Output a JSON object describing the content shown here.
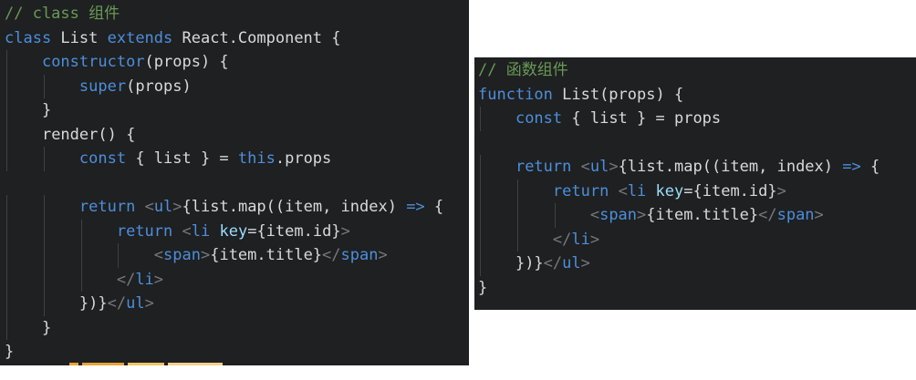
{
  "left_panel": {
    "lines": [
      {
        "indent": 0,
        "tokens": [
          [
            "cm",
            "// class 组件"
          ]
        ]
      },
      {
        "indent": 0,
        "tokens": [
          [
            "kw",
            "class"
          ],
          [
            "plain",
            " List "
          ],
          [
            "kw",
            "extends"
          ],
          [
            "plain",
            " React.Component {"
          ]
        ]
      },
      {
        "indent": 1,
        "tokens": [
          [
            "kw",
            "constructor"
          ],
          [
            "plain",
            "(props) {"
          ]
        ]
      },
      {
        "indent": 2,
        "tokens": [
          [
            "kw",
            "super"
          ],
          [
            "plain",
            "(props)"
          ]
        ]
      },
      {
        "indent": 1,
        "tokens": [
          [
            "plain",
            "}"
          ]
        ]
      },
      {
        "indent": 1,
        "tokens": [
          [
            "plain",
            "render() {"
          ]
        ]
      },
      {
        "indent": 2,
        "tokens": [
          [
            "kw",
            "const"
          ],
          [
            "plain",
            " { list } = "
          ],
          [
            "kw",
            "this"
          ],
          [
            "plain",
            ".props"
          ]
        ]
      },
      {
        "indent": 0,
        "tokens": []
      },
      {
        "indent": 2,
        "tokens": [
          [
            "kw",
            "return"
          ],
          [
            "plain",
            " "
          ],
          [
            "br",
            "<"
          ],
          [
            "tg",
            "ul"
          ],
          [
            "br",
            ">"
          ],
          [
            "plain",
            "{list.map((item, index) "
          ],
          [
            "kw",
            "=>"
          ],
          [
            "plain",
            " {"
          ]
        ]
      },
      {
        "indent": 3,
        "tokens": [
          [
            "kw",
            "return"
          ],
          [
            "plain",
            " "
          ],
          [
            "br",
            "<"
          ],
          [
            "tg",
            "li"
          ],
          [
            "plain",
            " "
          ],
          [
            "at",
            "key"
          ],
          [
            "plain",
            "={item.id}"
          ],
          [
            "br",
            ">"
          ]
        ]
      },
      {
        "indent": 4,
        "tokens": [
          [
            "br",
            "<"
          ],
          [
            "tg",
            "span"
          ],
          [
            "br",
            ">"
          ],
          [
            "plain",
            "{item.title}"
          ],
          [
            "br",
            "</"
          ],
          [
            "tg",
            "span"
          ],
          [
            "br",
            ">"
          ]
        ]
      },
      {
        "indent": 3,
        "tokens": [
          [
            "br",
            "</"
          ],
          [
            "tg",
            "li"
          ],
          [
            "br",
            ">"
          ]
        ]
      },
      {
        "indent": 2,
        "tokens": [
          [
            "plain",
            "})}"
          ],
          [
            "br",
            "</"
          ],
          [
            "tg",
            "ul"
          ],
          [
            "br",
            ">"
          ]
        ]
      },
      {
        "indent": 1,
        "tokens": [
          [
            "plain",
            "}"
          ]
        ]
      },
      {
        "indent": 0,
        "tokens": [
          [
            "plain",
            "}"
          ]
        ]
      }
    ]
  },
  "right_panel": {
    "lines": [
      {
        "indent": 0,
        "tokens": [
          [
            "cm",
            "// 函数组件"
          ]
        ]
      },
      {
        "indent": 0,
        "tokens": [
          [
            "kw",
            "function"
          ],
          [
            "plain",
            " List(props) {"
          ]
        ]
      },
      {
        "indent": 1,
        "tokens": [
          [
            "kw",
            "const"
          ],
          [
            "plain",
            " { list } = "
          ],
          [
            "plain",
            "props"
          ]
        ]
      },
      {
        "indent": 0,
        "tokens": []
      },
      {
        "indent": 1,
        "tokens": [
          [
            "kw",
            "return"
          ],
          [
            "plain",
            " "
          ],
          [
            "br",
            "<"
          ],
          [
            "tg",
            "ul"
          ],
          [
            "br",
            ">"
          ],
          [
            "plain",
            "{list.map((item, index) "
          ],
          [
            "kw",
            "=>"
          ],
          [
            "plain",
            " {"
          ]
        ]
      },
      {
        "indent": 2,
        "tokens": [
          [
            "kw",
            "return"
          ],
          [
            "plain",
            " "
          ],
          [
            "br",
            "<"
          ],
          [
            "tg",
            "li"
          ],
          [
            "plain",
            " "
          ],
          [
            "at",
            "key"
          ],
          [
            "plain",
            "={item.id}"
          ],
          [
            "br",
            ">"
          ]
        ]
      },
      {
        "indent": 3,
        "tokens": [
          [
            "br",
            "<"
          ],
          [
            "tg",
            "span"
          ],
          [
            "br",
            ">"
          ],
          [
            "plain",
            "{item.title}"
          ],
          [
            "br",
            "</"
          ],
          [
            "tg",
            "span"
          ],
          [
            "br",
            ">"
          ]
        ]
      },
      {
        "indent": 2,
        "tokens": [
          [
            "br",
            "</"
          ],
          [
            "tg",
            "li"
          ],
          [
            "br",
            ">"
          ]
        ]
      },
      {
        "indent": 1,
        "tokens": [
          [
            "plain",
            "})}"
          ],
          [
            "br",
            "</"
          ],
          [
            "tg",
            "ul"
          ],
          [
            "br",
            ">"
          ]
        ]
      },
      {
        "indent": 0,
        "tokens": [
          [
            "plain",
            "}"
          ]
        ]
      }
    ]
  },
  "colors": {
    "background": "#1e2021",
    "comment": "#6a9955",
    "keyword": "#4e8edb",
    "text": "#d7dadc",
    "bracket": "#76797c",
    "attribute": "#9cdcfe"
  }
}
